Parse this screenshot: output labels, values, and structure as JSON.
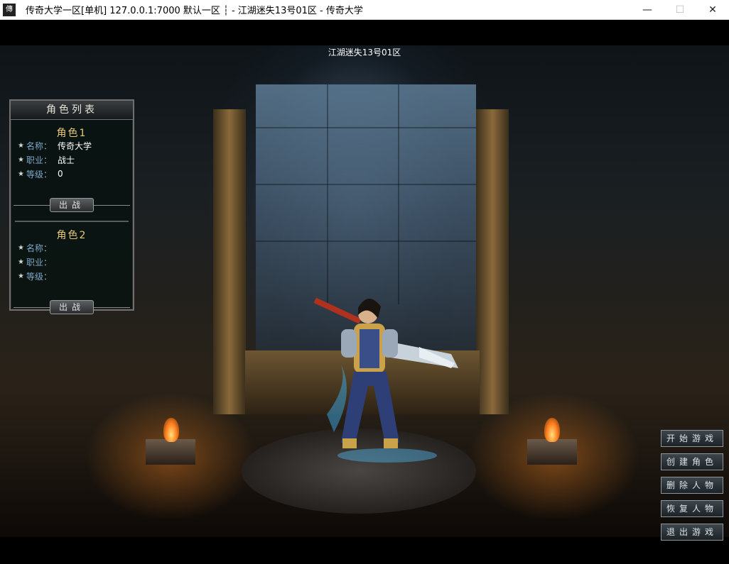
{
  "window": {
    "icon_text": "傳",
    "title": "传奇大学一区[单机] 127.0.0.1:7000  默认一区 ┆ - 江湖迷失13号01区 - 传奇大学",
    "minimize": "—",
    "maximize": "☐",
    "close": "✕"
  },
  "game": {
    "server_name": "江湖迷失13号01区",
    "panel": {
      "title": "角色列表",
      "slots": [
        {
          "title": "角色1",
          "name_label": "名称：",
          "name": "传奇大学",
          "job_label": "职业：",
          "job": "战士",
          "level_label": "等级：",
          "level": "0",
          "play_label": "出战"
        },
        {
          "title": "角色2",
          "name_label": "名称：",
          "name": "",
          "job_label": "职业：",
          "job": "",
          "level_label": "等级：",
          "level": "",
          "play_label": "出战"
        }
      ]
    },
    "menu": {
      "start": "开始游戏",
      "create": "创建角色",
      "delete": "删除人物",
      "restore": "恢复人物",
      "exit": "退出游戏"
    }
  },
  "colors": {
    "panel_bg": "#08120f",
    "slot_title": "#e7c978",
    "field_label": "#7fa7c9"
  }
}
